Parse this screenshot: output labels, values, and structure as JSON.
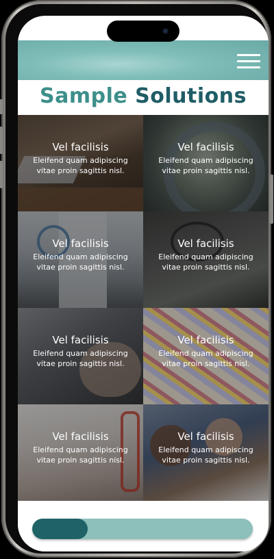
{
  "header": {
    "menu_icon": "hamburger-menu-icon",
    "title_part1": "Sample",
    "title_part2": "Solutions"
  },
  "tiles": [
    {
      "title": "Vel facilisis",
      "text": "Eleifend quam adipiscing vitae proin sagittis nisl."
    },
    {
      "title": "Vel facilisis",
      "text": "Eleifend quam adipiscing vitae proin sagittis nisl."
    },
    {
      "title": "Vel facilisis",
      "text": "Eleifend quam adipiscing vitae proin sagittis nisl."
    },
    {
      "title": "Vel facilisis",
      "text": "Eleifend quam adipiscing vitae proin sagittis nisl."
    },
    {
      "title": "Vel facilisis",
      "text": "Eleifend quam adipiscing vitae proin sagittis nisl."
    },
    {
      "title": "Vel facilisis",
      "text": "Eleifend quam adipiscing vitae proin sagittis nisl."
    },
    {
      "title": "Vel facilisis",
      "text": "Eleifend quam adipiscing vitae proin sagittis nisl."
    },
    {
      "title": "Vel facilisis",
      "text": "Eleifend quam adipiscing vitae proin sagittis nisl."
    }
  ],
  "progress": {
    "value_fraction": 0.25
  },
  "colors": {
    "header_teal": "#7ebdb8",
    "title_light": "#3d8f8a",
    "title_dark": "#1f5d66",
    "progress_fill": "#1f6367",
    "progress_track": "#8dbfbb"
  }
}
